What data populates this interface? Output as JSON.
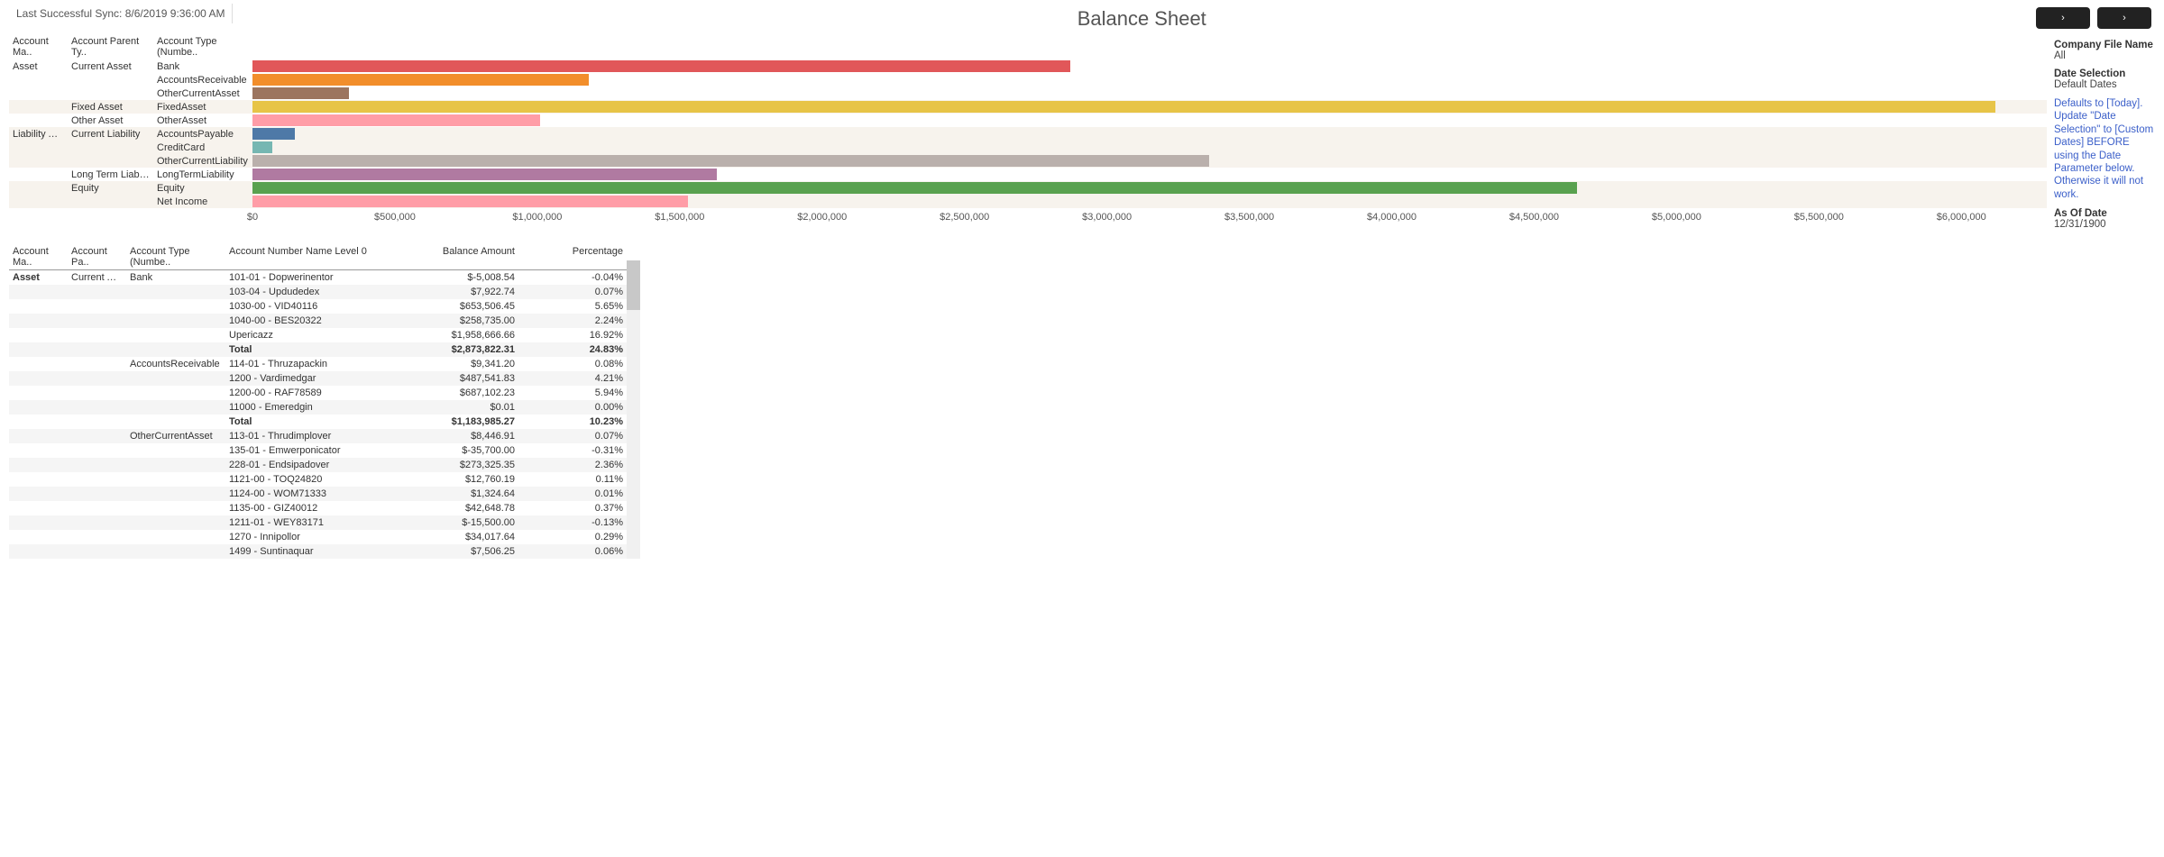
{
  "meta": {
    "sync_label": "Last Successful Sync: 8/6/2019 9:36:00 AM",
    "title": "Balance Sheet"
  },
  "sidebar": {
    "company_hdr": "Company File Name",
    "company_val": "All",
    "date_sel_hdr": "Date Selection",
    "date_sel_val": "Default Dates",
    "note": "Defaults to [Today]. Update \"Date Selection\" to [Custom Dates] BEFORE using the Date Parameter below. Otherwise it will not work.",
    "asof_hdr": "As Of Date",
    "asof_val": "12/31/1900"
  },
  "bar_headers": {
    "am": "Account Ma..",
    "apt": "Account Parent Ty..",
    "at": "Account Type (Numbe.."
  },
  "chart_data": {
    "type": "bar",
    "xlabel": "",
    "ylabel": "",
    "xlim": [
      0,
      6300000
    ],
    "ticks": [
      "$0",
      "$500,000",
      "$1,000,000",
      "$1,500,000",
      "$2,000,000",
      "$2,500,000",
      "$3,000,000",
      "$3,500,000",
      "$4,000,000",
      "$4,500,000",
      "$5,000,000",
      "$5,500,000",
      "$6,000,000"
    ],
    "rows": [
      {
        "am": "Asset",
        "apt": "Current Asset",
        "at": "Bank",
        "value": 2870000,
        "color": "#e15759",
        "alt": false
      },
      {
        "am": "",
        "apt": "",
        "at": "AccountsReceivable",
        "value": 1180000,
        "color": "#f28e2b",
        "alt": false
      },
      {
        "am": "",
        "apt": "",
        "at": "OtherCurrentAsset",
        "value": 340000,
        "color": "#9c755f",
        "alt": false
      },
      {
        "am": "",
        "apt": "Fixed Asset",
        "at": "FixedAsset",
        "value": 6120000,
        "color": "#e7c447",
        "alt": true
      },
      {
        "am": "",
        "apt": "Other Asset",
        "at": "OtherAsset",
        "value": 1010000,
        "color": "#ff9da7",
        "alt": false
      },
      {
        "am": "Liability And Equity",
        "apt": "Current Liability",
        "at": "AccountsPayable",
        "value": 150000,
        "color": "#4e79a7",
        "alt": true,
        "tall": true
      },
      {
        "am": "",
        "apt": "",
        "at": "CreditCard",
        "value": 70000,
        "color": "#76b7b2",
        "alt": true
      },
      {
        "am": "",
        "apt": "",
        "at": "OtherCurrentLiability",
        "value": 3360000,
        "color": "#bab0ac",
        "alt": true
      },
      {
        "am": "",
        "apt": "Long Term Liability",
        "at": "LongTermLiability",
        "value": 1630000,
        "color": "#b07aa1",
        "alt": false
      },
      {
        "am": "",
        "apt": "Equity",
        "at": "Equity",
        "value": 4650000,
        "color": "#59a14f",
        "alt": true
      },
      {
        "am": "",
        "apt": "",
        "at": "Net Income",
        "value": 1530000,
        "color": "#ff9da7",
        "alt": true
      }
    ]
  },
  "detail_headers": {
    "am": "Account Ma..",
    "apt": "Account Pa..",
    "at": "Account Type (Numbe..",
    "an": "Account Number Name Level 0",
    "bal": "Balance Amount",
    "pct": "Percentage"
  },
  "detail_rows": [
    {
      "am": "Asset",
      "apt": "Current Asset",
      "at": "Bank",
      "an": "101-01 - Dopwerinentor",
      "bal": "$-5,008.54",
      "pct": "-0.04%",
      "alt": false,
      "bold_am": true
    },
    {
      "am": "",
      "apt": "",
      "at": "",
      "an": "103-04 - Updudedex",
      "bal": "$7,922.74",
      "pct": "0.07%",
      "alt": true
    },
    {
      "am": "",
      "apt": "",
      "at": "",
      "an": "1030-00 - VID40116",
      "bal": "$653,506.45",
      "pct": "5.65%",
      "alt": false
    },
    {
      "am": "",
      "apt": "",
      "at": "",
      "an": "1040-00 - BES20322",
      "bal": "$258,735.00",
      "pct": "2.24%",
      "alt": true
    },
    {
      "am": "",
      "apt": "",
      "at": "",
      "an": "Upericazz",
      "bal": "$1,958,666.66",
      "pct": "16.92%",
      "alt": false
    },
    {
      "am": "",
      "apt": "",
      "at": "",
      "an": "Total",
      "bal": "$2,873,822.31",
      "pct": "24.83%",
      "alt": true,
      "total": true
    },
    {
      "am": "",
      "apt": "",
      "at": "AccountsReceivable",
      "an": "114-01 - Thruzapackin",
      "bal": "$9,341.20",
      "pct": "0.08%",
      "alt": false
    },
    {
      "am": "",
      "apt": "",
      "at": "",
      "an": "1200 - Vardimedgar",
      "bal": "$487,541.83",
      "pct": "4.21%",
      "alt": true
    },
    {
      "am": "",
      "apt": "",
      "at": "",
      "an": "1200-00 - RAF78589",
      "bal": "$687,102.23",
      "pct": "5.94%",
      "alt": false
    },
    {
      "am": "",
      "apt": "",
      "at": "",
      "an": "11000 - Emeredgin",
      "bal": "$0.01",
      "pct": "0.00%",
      "alt": true
    },
    {
      "am": "",
      "apt": "",
      "at": "",
      "an": "Total",
      "bal": "$1,183,985.27",
      "pct": "10.23%",
      "alt": false,
      "total": true
    },
    {
      "am": "",
      "apt": "",
      "at": "OtherCurrentAsset",
      "an": "113-01 - Thrudimplover",
      "bal": "$8,446.91",
      "pct": "0.07%",
      "alt": true
    },
    {
      "am": "",
      "apt": "",
      "at": "",
      "an": "135-01 - Emwerponicator",
      "bal": "$-35,700.00",
      "pct": "-0.31%",
      "alt": false
    },
    {
      "am": "",
      "apt": "",
      "at": "",
      "an": "228-01 - Endsipadover",
      "bal": "$273,325.35",
      "pct": "2.36%",
      "alt": true
    },
    {
      "am": "",
      "apt": "",
      "at": "",
      "an": "1121-00 - TOQ24820",
      "bal": "$12,760.19",
      "pct": "0.11%",
      "alt": false
    },
    {
      "am": "",
      "apt": "",
      "at": "",
      "an": "1124-00 - WOM71333",
      "bal": "$1,324.64",
      "pct": "0.01%",
      "alt": true
    },
    {
      "am": "",
      "apt": "",
      "at": "",
      "an": "1135-00 - GIZ40012",
      "bal": "$42,648.78",
      "pct": "0.37%",
      "alt": false
    },
    {
      "am": "",
      "apt": "",
      "at": "",
      "an": "1211-01 - WEY83171",
      "bal": "$-15,500.00",
      "pct": "-0.13%",
      "alt": true
    },
    {
      "am": "",
      "apt": "",
      "at": "",
      "an": "1270 - Innipollor",
      "bal": "$34,017.64",
      "pct": "0.29%",
      "alt": false
    },
    {
      "am": "",
      "apt": "",
      "at": "",
      "an": "1499 - Suntinaquar",
      "bal": "$7,506.25",
      "pct": "0.06%",
      "alt": true
    }
  ]
}
